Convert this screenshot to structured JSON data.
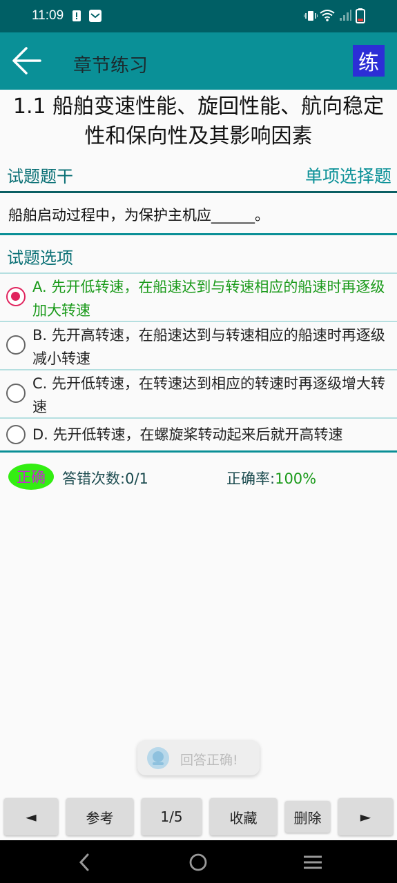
{
  "status_bar": {
    "time": "11:09"
  },
  "app_bar": {
    "title": "章节练习",
    "badge": "练"
  },
  "chapter": {
    "title": "1.1 船舶变速性能、旋回性能、航向稳定性和保向性及其影响因素"
  },
  "question": {
    "stem_label": "试题题干",
    "type": "单项选择题",
    "stem": "船舶启动过程中，为保护主机应______。",
    "options_label": "试题选项",
    "options": [
      {
        "text": "A. 先开低转速，在船速达到与转速相应的船速时再逐级加大转速",
        "selected": true
      },
      {
        "text": "B. 先开高转速，在船速达到与转速相应的船速时再逐级减小转速",
        "selected": false
      },
      {
        "text": "C. 先开低转速，在转速达到相应的转速时再逐级增大转速",
        "selected": false
      },
      {
        "text": "D. 先开低转速，在螺旋桨转动起来后就开高转速",
        "selected": false
      }
    ]
  },
  "result": {
    "badge": "正确",
    "wrong_label": "答错次数:",
    "wrong_value": "0/1",
    "accuracy_label": "正确率:",
    "accuracy_value": "100%"
  },
  "toast": {
    "text": "回答正确!"
  },
  "toolbar": {
    "prev": "◄",
    "reference": "参考",
    "page": "1/5",
    "favorite": "收藏",
    "delete": "删除",
    "next": "►"
  },
  "colors": {
    "accent": "#0a9097",
    "status": "#005f65",
    "correct": "#1a9a1a",
    "selected": "#e0245e"
  },
  "icons": [
    "back-arrow-icon",
    "vibrate-icon",
    "wifi-icon",
    "signal-icon",
    "battery-icon",
    "nav-back-icon",
    "nav-home-icon",
    "nav-menu-icon"
  ]
}
